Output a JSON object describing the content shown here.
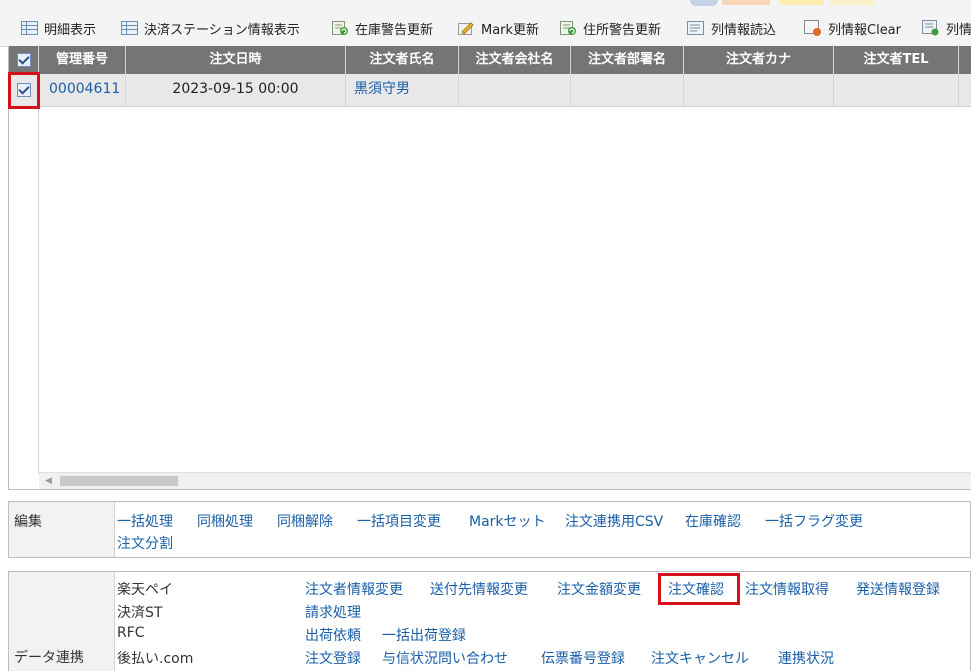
{
  "toolbar": {
    "items": [
      {
        "label": "明細表示",
        "icon": "table-icon"
      },
      {
        "label": "決済ステーション情報表示",
        "icon": "table-icon"
      },
      {
        "label": "在庫警告更新",
        "icon": "refresh-icon"
      },
      {
        "label": "Mark更新",
        "icon": "pencil-icon"
      },
      {
        "label": "住所警告更新",
        "icon": "refresh-icon"
      },
      {
        "label": "列情報読込",
        "icon": "list-icon"
      },
      {
        "label": "列情報Clear",
        "icon": "clear-icon"
      },
      {
        "label": "列情",
        "icon": "list-icon"
      }
    ]
  },
  "grid": {
    "headers": [
      "管理番号",
      "注文日時",
      "注文者氏名",
      "注文者会社名",
      "注文者部署名",
      "注文者カナ",
      "注文者TEL"
    ],
    "rows": [
      {
        "checked": true,
        "kanri": "00004611",
        "date": "2023-09-15 00:00",
        "name": "黒須守男",
        "company": "",
        "dept": "",
        "kana": "",
        "tel": ""
      }
    ]
  },
  "edit_panel": {
    "label": "編集",
    "links": [
      "一括処理",
      "同梱処理",
      "同梱解除",
      "一括項目変更",
      "Markセット",
      "注文連携用CSV",
      "在庫確認",
      "一括フラグ変更",
      "注文分割"
    ]
  },
  "data_panel": {
    "label": "データ連携",
    "rows": [
      {
        "service": "楽天ペイ",
        "links": [
          "注文者情報変更",
          "送付先情報変更",
          "注文金額変更",
          "注文確認",
          "注文情報取得",
          "発送情報登録"
        ]
      },
      {
        "service": "決済ST",
        "links": [
          "請求処理"
        ]
      },
      {
        "service": "RFC",
        "links": [
          "出荷依頼",
          "一括出荷登録"
        ]
      },
      {
        "service": "後払い.com",
        "links": [
          "注文登録",
          "与信状況問い合わせ",
          "伝票番号登録",
          "注文キャンセル",
          "連携状況"
        ]
      }
    ]
  },
  "colors": {
    "accent_highlight": "#d5101a",
    "link": "#1a5fa8",
    "header_bg": "#757575"
  }
}
